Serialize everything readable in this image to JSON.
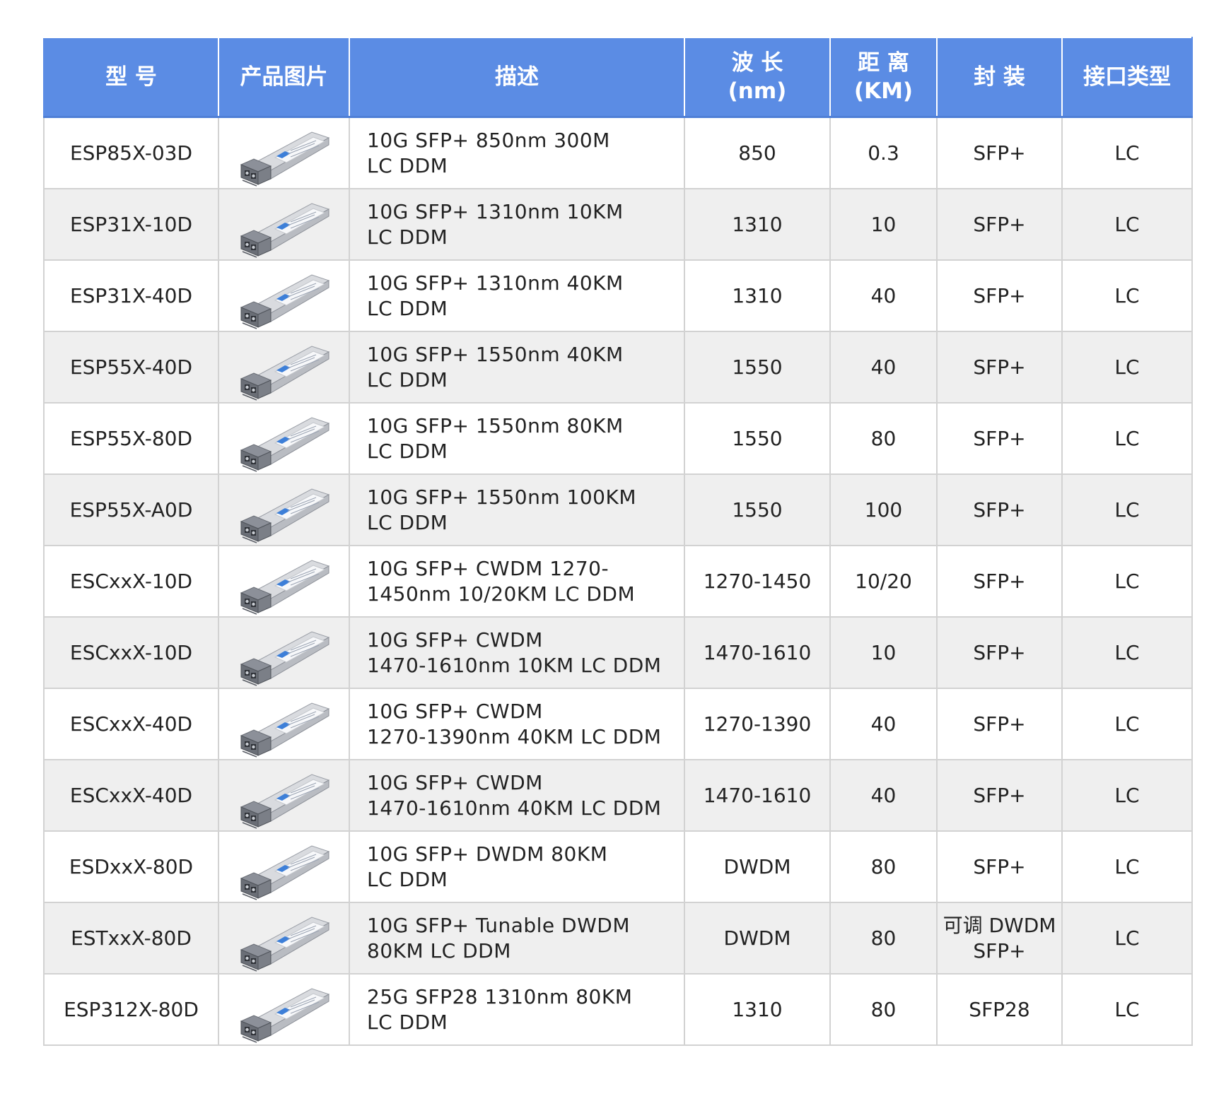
{
  "headers": {
    "model": "型 号",
    "image": "产品图片",
    "desc": "描述",
    "wavelength": [
      "波 长",
      "(nm)"
    ],
    "distance": [
      "距 离",
      "(KM)"
    ],
    "package": "封 装",
    "interface": "接口类型"
  },
  "rows": [
    {
      "model": "ESP85X-03D",
      "desc": [
        "10G SFP+ 850nm 300M",
        "LC DDM"
      ],
      "wavelength": "850",
      "distance": "0.3",
      "package": [
        "SFP+"
      ],
      "interface": "LC"
    },
    {
      "model": "ESP31X-10D",
      "desc": [
        "10G SFP+ 1310nm 10KM",
        "LC DDM"
      ],
      "wavelength": "1310",
      "distance": "10",
      "package": [
        "SFP+"
      ],
      "interface": "LC"
    },
    {
      "model": "ESP31X-40D",
      "desc": [
        "10G SFP+ 1310nm 40KM",
        "LC DDM"
      ],
      "wavelength": "1310",
      "distance": "40",
      "package": [
        "SFP+"
      ],
      "interface": "LC"
    },
    {
      "model": "ESP55X-40D",
      "desc": [
        "10G SFP+ 1550nm 40KM",
        "LC DDM"
      ],
      "wavelength": "1550",
      "distance": "40",
      "package": [
        "SFP+"
      ],
      "interface": "LC"
    },
    {
      "model": "ESP55X-80D",
      "desc": [
        "10G SFP+ 1550nm 80KM",
        "LC DDM"
      ],
      "wavelength": "1550",
      "distance": "80",
      "package": [
        "SFP+"
      ],
      "interface": "LC"
    },
    {
      "model": "ESP55X-A0D",
      "desc": [
        "10G SFP+ 1550nm 100KM",
        "LC DDM"
      ],
      "wavelength": "1550",
      "distance": "100",
      "package": [
        "SFP+"
      ],
      "interface": "LC"
    },
    {
      "model": "ESCxxX-10D",
      "desc": [
        "10G SFP+ CWDM 1270-",
        "1450nm 10/20KM LC DDM"
      ],
      "wavelength": "1270-1450",
      "distance": "10/20",
      "package": [
        "SFP+"
      ],
      "interface": "LC"
    },
    {
      "model": "ESCxxX-10D",
      "desc": [
        "10G SFP+ CWDM",
        "1470-1610nm 10KM LC DDM"
      ],
      "wavelength": "1470-1610",
      "distance": "10",
      "package": [
        "SFP+"
      ],
      "interface": "LC"
    },
    {
      "model": "ESCxxX-40D",
      "desc": [
        "10G SFP+ CWDM",
        "1270-1390nm 40KM LC DDM"
      ],
      "wavelength": "1270-1390",
      "distance": "40",
      "package": [
        "SFP+"
      ],
      "interface": "LC"
    },
    {
      "model": "ESCxxX-40D",
      "desc": [
        "10G SFP+ CWDM",
        "1470-1610nm 40KM LC DDM"
      ],
      "wavelength": "1470-1610",
      "distance": "40",
      "package": [
        "SFP+"
      ],
      "interface": "LC"
    },
    {
      "model": "ESDxxX-80D",
      "desc": [
        "10G SFP+ DWDM 80KM",
        "LC DDM"
      ],
      "wavelength": "DWDM",
      "distance": "80",
      "package": [
        "SFP+"
      ],
      "interface": "LC"
    },
    {
      "model": "ESTxxX-80D",
      "desc": [
        "10G SFP+ Tunable DWDM",
        "80KM LC DDM"
      ],
      "wavelength": "DWDM",
      "distance": "80",
      "package": [
        "可调 DWDM",
        "SFP+"
      ],
      "interface": "LC"
    },
    {
      "model": "ESP312X-80D",
      "desc": [
        "25G SFP28 1310nm 80KM",
        "LC DDM"
      ],
      "wavelength": "1310",
      "distance": "80",
      "package": [
        "SFP28"
      ],
      "interface": "LC"
    }
  ]
}
